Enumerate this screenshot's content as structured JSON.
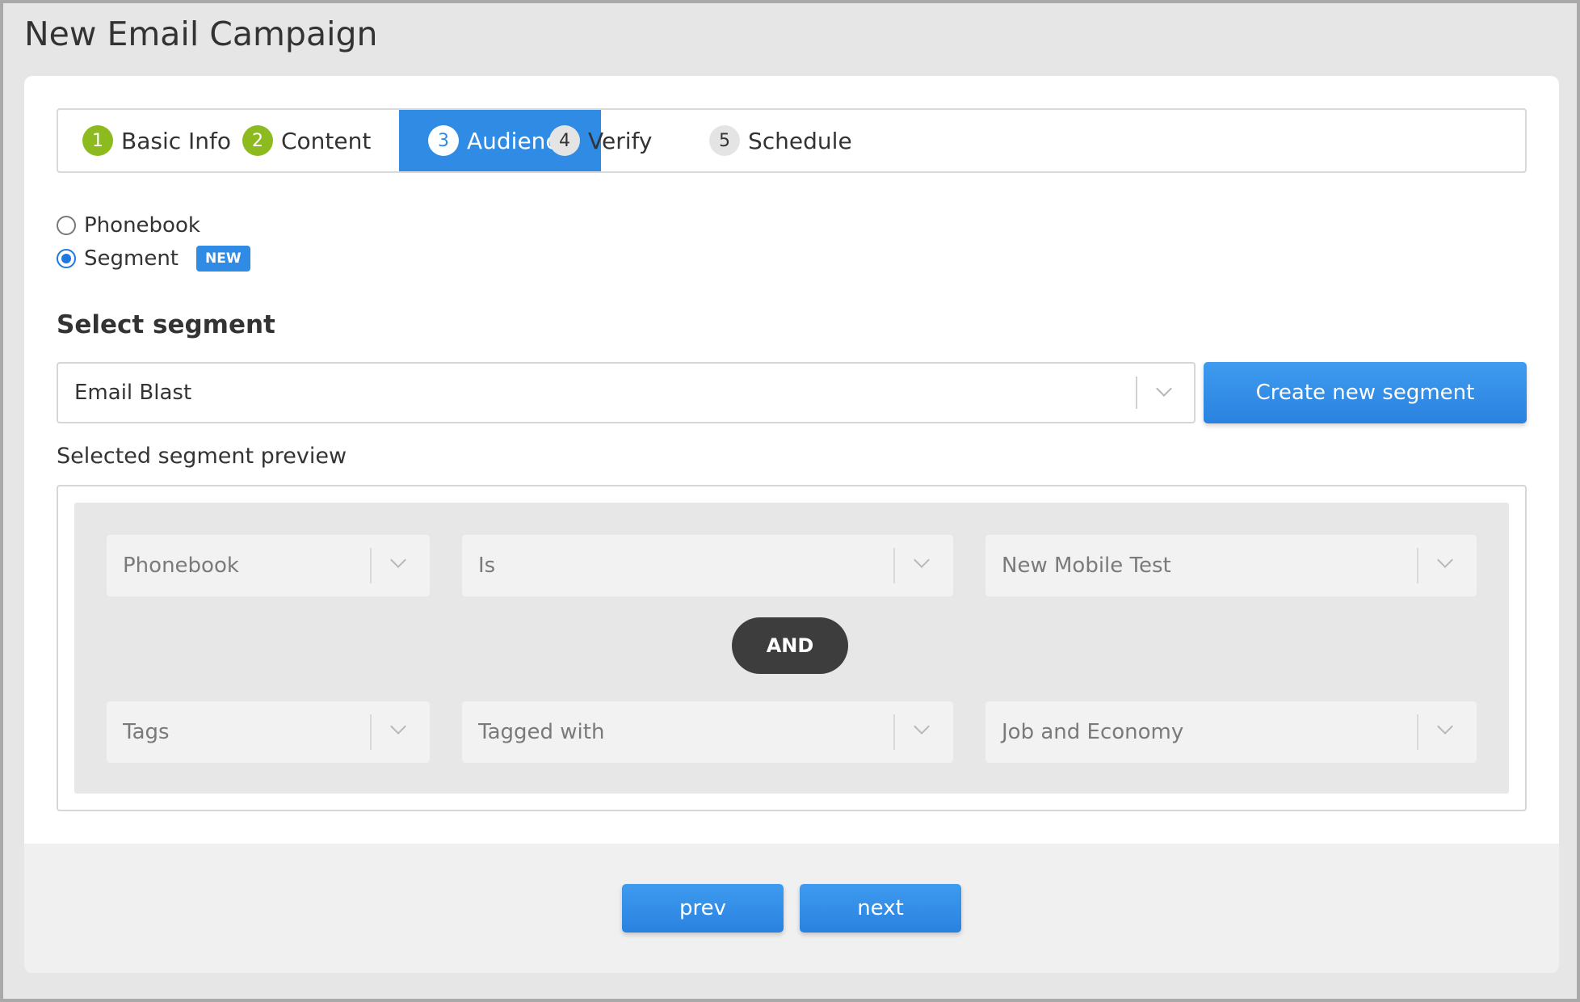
{
  "page": {
    "title": "New Email Campaign"
  },
  "steps": [
    {
      "number": "1",
      "label": "Basic Info",
      "state": "done"
    },
    {
      "number": "2",
      "label": "Content",
      "state": "done"
    },
    {
      "number": "3",
      "label": "Audience",
      "state": "active"
    },
    {
      "number": "4",
      "label": "Verify",
      "state": "pending"
    },
    {
      "number": "5",
      "label": "Schedule",
      "state": "pending"
    }
  ],
  "audience": {
    "options": [
      {
        "label": "Phonebook",
        "selected": false
      },
      {
        "label": "Segment",
        "selected": true,
        "badge": "NEW"
      }
    ]
  },
  "segment": {
    "section_title": "Select segment",
    "selected_value": "Email Blast",
    "create_button": "Create new segment",
    "preview_label": "Selected segment preview",
    "conditions": [
      {
        "field": "Phonebook",
        "operator": "Is",
        "value": "New Mobile Test"
      },
      {
        "field": "Tags",
        "operator": "Tagged with",
        "value": "Job and Economy"
      }
    ],
    "joiner": "AND"
  },
  "footer": {
    "prev_label": "prev",
    "next_label": "next"
  },
  "colors": {
    "accent": "#2f8be4",
    "done_step": "#8dbb1f",
    "and_pill": "#3d3d3d"
  },
  "icons": [
    "chevron-down-icon",
    "radio-icon"
  ]
}
